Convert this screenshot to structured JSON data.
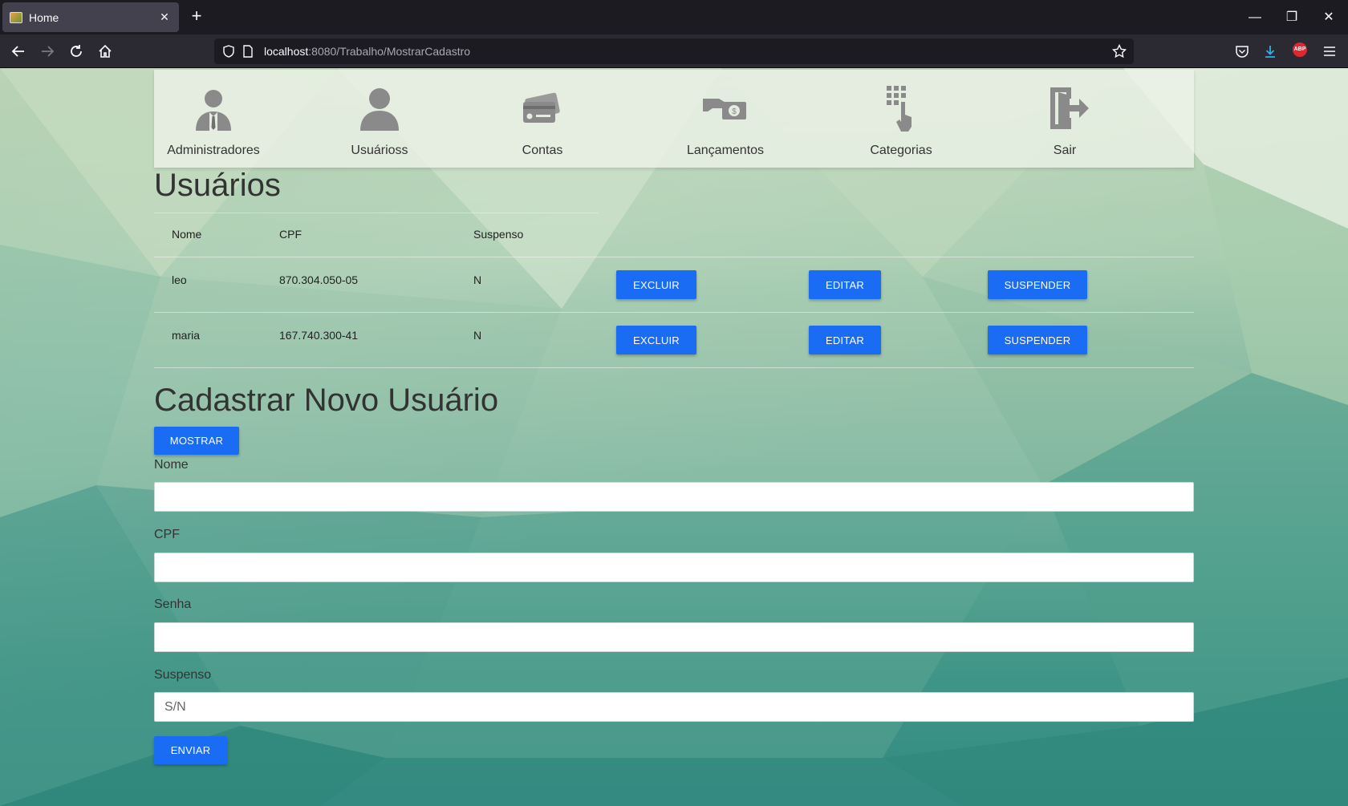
{
  "browser": {
    "tab_title": "Home",
    "url_host": "localhost",
    "url_path": ":8080/Trabalho/MostrarCadastro",
    "abp_label": "ABP"
  },
  "menu": {
    "items": [
      {
        "label": "Administradores",
        "icon": "admin-icon"
      },
      {
        "label": "Usuárioss",
        "icon": "user-icon"
      },
      {
        "label": "Contas",
        "icon": "credit-card-icon"
      },
      {
        "label": "Lançamentos",
        "icon": "money-hand-icon"
      },
      {
        "label": "Categorias",
        "icon": "grid-hand-icon"
      },
      {
        "label": "Sair",
        "icon": "exit-door-icon"
      }
    ]
  },
  "users_section": {
    "title": "Usuários",
    "columns": [
      "Nome",
      "CPF",
      "Suspenso"
    ],
    "rows": [
      {
        "nome": "leo",
        "cpf": "870.304.050-05",
        "suspenso": "N"
      },
      {
        "nome": "maria",
        "cpf": "167.740.300-41",
        "suspenso": "N"
      }
    ],
    "actions": {
      "delete": "EXCLUIR",
      "edit": "EDITAR",
      "suspend": "SUSPENDER"
    }
  },
  "form": {
    "title": "Cadastrar Novo Usuário",
    "show_button": "MOSTRAR",
    "fields": {
      "nome": {
        "label": "Nome",
        "value": "",
        "placeholder": ""
      },
      "cpf": {
        "label": "CPF",
        "value": "",
        "placeholder": ""
      },
      "senha": {
        "label": "Senha",
        "value": "",
        "placeholder": ""
      },
      "suspenso": {
        "label": "Suspenso",
        "value": "",
        "placeholder": "S/N"
      }
    },
    "submit_button": "ENVIAR"
  },
  "colors": {
    "primary_button": "#1a6cf5",
    "browser_bg": "#1c1b22",
    "abp_red": "#e0262e"
  }
}
